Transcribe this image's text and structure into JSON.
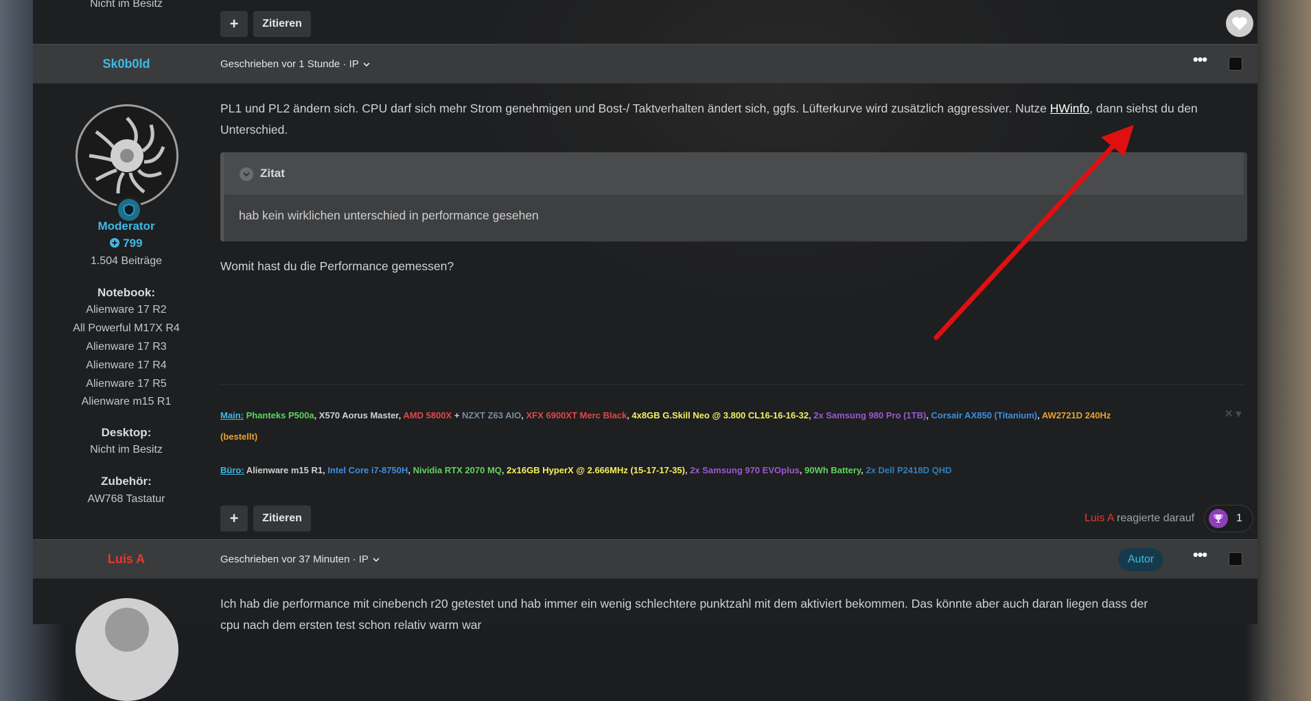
{
  "top_post": {
    "side_value": "Nicht im Besitz",
    "plus_label": "+",
    "quote_label": "Zitieren"
  },
  "post1": {
    "username": "Sk0b0ld",
    "posted": "Geschrieben vor 1 Stunde · IP",
    "role": "Moderator",
    "reputation": "799",
    "posts_count": "1.504 Beiträge",
    "notebook_label": "Notebook:",
    "notebooks": [
      "Alienware 17 R2",
      "All Powerful M17X R4",
      "Alienware 17 R3",
      "Alienware 17 R4",
      "Alienware 17 R5",
      "Alienware m15 R1"
    ],
    "desktop_label": "Desktop:",
    "desktop_value": "Nicht im Besitz",
    "accessories_label": "Zubehör:",
    "accessories_value": "AW768 Tastatur",
    "text_before_link": "PL1 und PL2 ändern sich. CPU darf sich mehr Strom genehmigen und Bost-/ Taktverhalten ändert sich, ggfs. Lüfterkurve wird zusätzlich aggressiver. Nutze ",
    "link_text": "HWinfo",
    "text_after_link": ", dann siehst du den Unterschied.",
    "quote_title": "Zitat",
    "quote_text": "hab kein wirklichen unterschied in performance gesehen",
    "reply_text": "Womit hast du die Performance gemessen?",
    "sig_main": [
      {
        "text": "Main:",
        "color": "#3dbbe8",
        "underline": true
      },
      {
        "text": " Phanteks P500a",
        "color": "#5fd35f"
      },
      {
        "text": ", X570 Aorus Master, ",
        "color": "#d0d0d0"
      },
      {
        "text": "AMD 5800X",
        "color": "#e04848"
      },
      {
        "text": " + ",
        "color": "#d0d0d0"
      },
      {
        "text": "NZXT Z63 AIO",
        "color": "#7a8da0"
      },
      {
        "text": ", ",
        "color": "#d0d0d0"
      },
      {
        "text": "XFX 6900XT Merc Black",
        "color": "#e04848"
      },
      {
        "text": ", ",
        "color": "#d0d0d0"
      },
      {
        "text": "4x8GB G.Skill Neo @ 3.800 CL16-16-16-32",
        "color": "#f4f060"
      },
      {
        "text": ", ",
        "color": "#d0d0d0"
      },
      {
        "text": "2x Samsung 980 Pro (1TB)",
        "color": "#9b59d0"
      },
      {
        "text": ", ",
        "color": "#d0d0d0"
      },
      {
        "text": "Corsair AX850 (Titanium)",
        "color": "#3d8fe0"
      },
      {
        "text": ", ",
        "color": "#d0d0d0"
      },
      {
        "text": "AW2721D 240Hz",
        "color": "#e8a030"
      }
    ],
    "sig_main_cont": "(bestellt)",
    "sig_buro": [
      {
        "text": "Büro:",
        "color": "#3dbbe8",
        "underline": true
      },
      {
        "text": " Alienware m15 R1, ",
        "color": "#d0d0d0"
      },
      {
        "text": "Intel Core i7-8750H",
        "color": "#3d8fe0"
      },
      {
        "text": ", ",
        "color": "#d0d0d0"
      },
      {
        "text": "Nividia RTX 2070 MQ",
        "color": "#5fd35f"
      },
      {
        "text": ", ",
        "color": "#d0d0d0"
      },
      {
        "text": "2x16GB HyperX @ 2.666MHz (15-17-17-35)",
        "color": "#f4f060"
      },
      {
        "text": ", ",
        "color": "#d0d0d0"
      },
      {
        "text": "2x Samsung 970 EVOplus",
        "color": "#9b59d0"
      },
      {
        "text": ", ",
        "color": "#d0d0d0"
      },
      {
        "text": "90Wh Battery",
        "color": "#5fd35f"
      },
      {
        "text": ", ",
        "color": "#d0d0d0"
      },
      {
        "text": "2x Dell P2418D QHD",
        "color": "#2f7fb8"
      }
    ],
    "plus_label": "+",
    "quote_label": "Zitieren",
    "reaction_user": "Luis A",
    "reaction_text": " reagierte darauf",
    "reaction_count": "1"
  },
  "post2": {
    "username": "Luis A",
    "posted": "Geschrieben vor 37 Minuten · IP",
    "author_badge": "Autor",
    "text_line1": "Ich hab die performance mit cinebench r20 getestet und hab immer ein wenig schlechtere punktzahl mit dem aktiviert bekommen. Das könnte aber auch daran liegen dass der",
    "text_line2": "cpu nach dem ersten test schon relativ warm war"
  },
  "colors": {
    "moderator": "#3dbbe8",
    "author_name": "#e83a2a",
    "annotation_arrow": "#e01010"
  },
  "icons": {
    "heart": "heart-icon",
    "shield": "shield-icon",
    "chevron": "chevron-down-icon",
    "trophy": "trophy-icon",
    "plus_circle": "plus-circle-icon"
  }
}
